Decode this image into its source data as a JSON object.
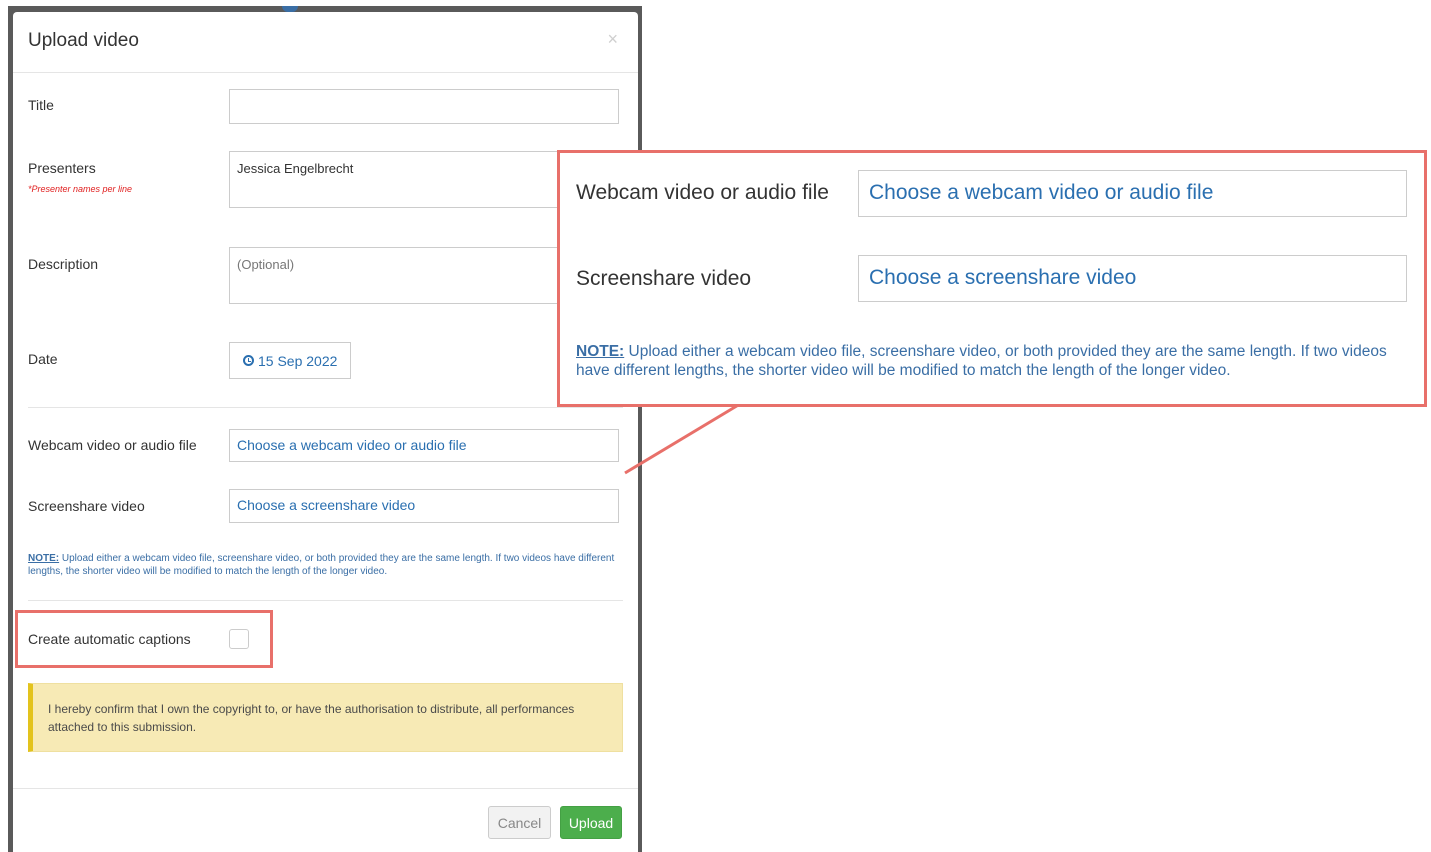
{
  "modal": {
    "title": "Upload video",
    "close_glyph": "×",
    "title_field": {
      "label": "Title",
      "value": ""
    },
    "presenters": {
      "label": "Presenters",
      "hint": "*Presenter names per line",
      "value": "Jessica Engelbrecht"
    },
    "description": {
      "label": "Description",
      "placeholder": "(Optional)"
    },
    "date": {
      "label": "Date",
      "value": "15 Sep 2022"
    },
    "webcam": {
      "label": "Webcam video or audio file",
      "button": "Choose a webcam video or audio file"
    },
    "screenshare": {
      "label": "Screenshare video",
      "button": "Choose a screenshare video"
    },
    "note": {
      "label": "NOTE:",
      "text": " Upload either a webcam video file, screenshare video, or both provided they are the same length. If two videos have different lengths, the shorter video will be modified to match the length of the longer video."
    },
    "captions": {
      "label": "Create automatic captions",
      "checked": false
    },
    "copyright": "I hereby confirm that I own the copyright to, or have the authorisation to distribute, all performances attached to this submission.",
    "buttons": {
      "cancel": "Cancel",
      "upload": "Upload"
    }
  },
  "callout": {
    "webcam_label": "Webcam video or audio file",
    "webcam_button": "Choose a webcam video or audio file",
    "screenshare_label": "Screenshare video",
    "screenshare_button": "Choose a screenshare video",
    "note_label": "NOTE:",
    "note_text": " Upload either a webcam video file, screenshare video, or both provided they are the same length. If two videos have different lengths, the shorter video will be modified to match the length of the longer video."
  },
  "colors": {
    "highlight": "#e8706a",
    "link": "#2a6fb0",
    "upload_button": "#4cae4c",
    "alert_background": "#f7eab5",
    "alert_border": "#e3c31d"
  }
}
